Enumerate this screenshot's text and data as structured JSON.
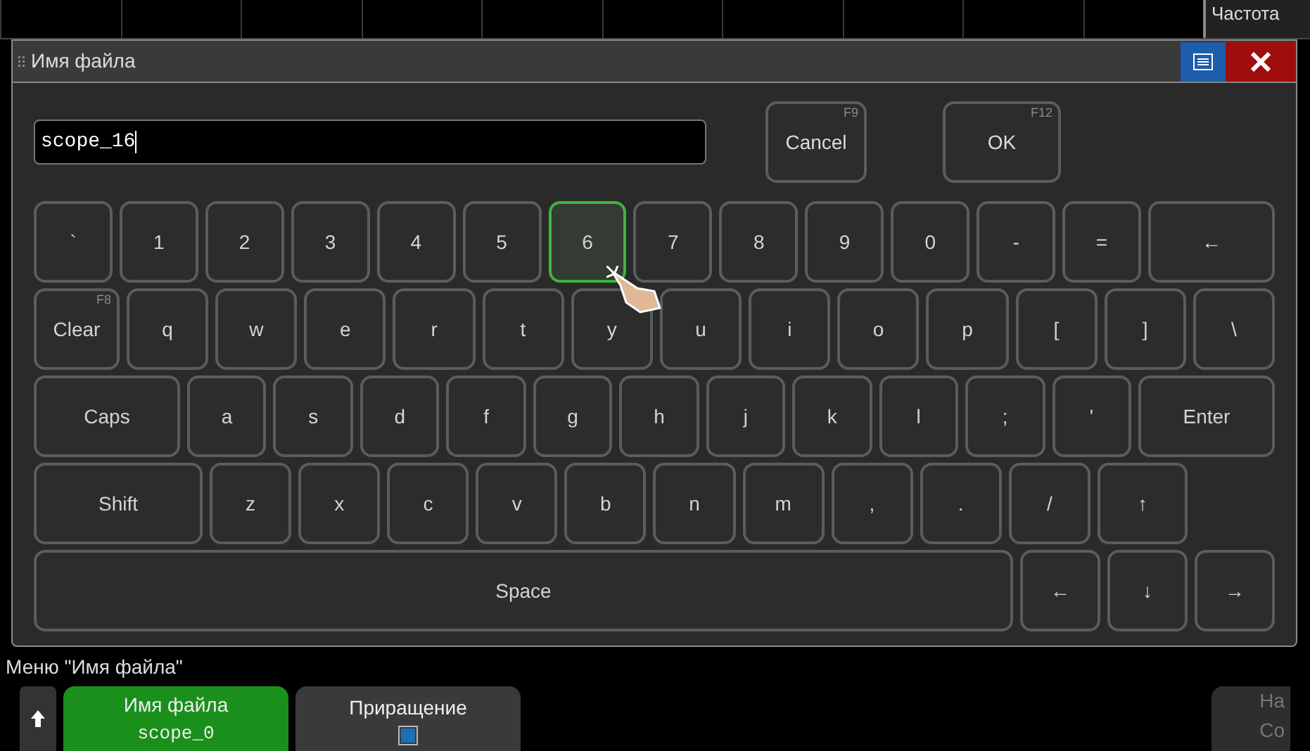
{
  "top_bar": {
    "label": "Частота"
  },
  "dialog": {
    "title": "Имя файла",
    "input": {
      "value": "scope_16"
    },
    "buttons": [
      {
        "label": "Cancel",
        "hint": "F9"
      },
      {
        "label": "OK",
        "hint": "F12"
      }
    ],
    "keyboard": [
      [
        {
          "label": "`",
          "kind": "char",
          "selected": false
        },
        {
          "label": "1",
          "kind": "char",
          "selected": false
        },
        {
          "label": "2",
          "kind": "char",
          "selected": false
        },
        {
          "label": "3",
          "kind": "char",
          "selected": false
        },
        {
          "label": "4",
          "kind": "char",
          "selected": false
        },
        {
          "label": "5",
          "kind": "char",
          "selected": false
        },
        {
          "label": "6",
          "kind": "char",
          "selected": true
        },
        {
          "label": "7",
          "kind": "char",
          "selected": false
        },
        {
          "label": "8",
          "kind": "char",
          "selected": false
        },
        {
          "label": "9",
          "kind": "char",
          "selected": false
        },
        {
          "label": "0",
          "kind": "char",
          "selected": false
        },
        {
          "label": "-",
          "kind": "char",
          "selected": false
        },
        {
          "label": "=",
          "kind": "char",
          "selected": false
        },
        {
          "label": "←",
          "kind": "backspace",
          "selected": false
        }
      ],
      [
        {
          "label": "Clear",
          "hint": "F8",
          "kind": "clear",
          "selected": false
        },
        {
          "label": "q",
          "kind": "char",
          "selected": false
        },
        {
          "label": "w",
          "kind": "char",
          "selected": false
        },
        {
          "label": "e",
          "kind": "char",
          "selected": false
        },
        {
          "label": "r",
          "kind": "char",
          "selected": false
        },
        {
          "label": "t",
          "kind": "char",
          "selected": false
        },
        {
          "label": "y",
          "kind": "char",
          "selected": false
        },
        {
          "label": "u",
          "kind": "char",
          "selected": false
        },
        {
          "label": "i",
          "kind": "char",
          "selected": false
        },
        {
          "label": "o",
          "kind": "char",
          "selected": false
        },
        {
          "label": "p",
          "kind": "char",
          "selected": false
        },
        {
          "label": "[",
          "kind": "char",
          "selected": false
        },
        {
          "label": "]",
          "kind": "char",
          "selected": false
        },
        {
          "label": "\\",
          "kind": "char",
          "selected": false
        }
      ],
      [
        {
          "label": "Caps",
          "kind": "caps",
          "selected": false
        },
        {
          "label": "a",
          "kind": "char",
          "selected": false
        },
        {
          "label": "s",
          "kind": "char",
          "selected": false
        },
        {
          "label": "d",
          "kind": "char",
          "selected": false
        },
        {
          "label": "f",
          "kind": "char",
          "selected": false
        },
        {
          "label": "g",
          "kind": "char",
          "selected": false
        },
        {
          "label": "h",
          "kind": "char",
          "selected": false
        },
        {
          "label": "j",
          "kind": "char",
          "selected": false
        },
        {
          "label": "k",
          "kind": "char",
          "selected": false
        },
        {
          "label": "l",
          "kind": "char",
          "selected": false
        },
        {
          "label": ";",
          "kind": "char",
          "selected": false
        },
        {
          "label": "'",
          "kind": "char",
          "selected": false
        },
        {
          "label": "Enter",
          "kind": "enter",
          "selected": false
        }
      ],
      [
        {
          "label": "Shift",
          "kind": "shift",
          "selected": false
        },
        {
          "label": "z",
          "kind": "char",
          "selected": false
        },
        {
          "label": "x",
          "kind": "char",
          "selected": false
        },
        {
          "label": "c",
          "kind": "char",
          "selected": false
        },
        {
          "label": "v",
          "kind": "char",
          "selected": false
        },
        {
          "label": "b",
          "kind": "char",
          "selected": false
        },
        {
          "label": "n",
          "kind": "char",
          "selected": false
        },
        {
          "label": "m",
          "kind": "char",
          "selected": false
        },
        {
          "label": ",",
          "kind": "char",
          "selected": false
        },
        {
          "label": ".",
          "kind": "char",
          "selected": false
        },
        {
          "label": "/",
          "kind": "char",
          "selected": false
        },
        {
          "label": "↑",
          "kind": "up",
          "selected": false
        }
      ],
      [
        {
          "label": "Space",
          "kind": "space",
          "selected": false
        },
        {
          "label": "←",
          "kind": "char",
          "selected": false
        },
        {
          "label": "↓",
          "kind": "char",
          "selected": false
        },
        {
          "label": "→",
          "kind": "char",
          "selected": false
        }
      ]
    ]
  },
  "menu": {
    "title": "Меню \"Имя файла\"",
    "softkeys": [
      {
        "kind": "name",
        "label": "Имя файла",
        "value": "scope_0",
        "selected": true
      },
      {
        "kind": "check",
        "label": "Приращение",
        "checked": true,
        "selected": false
      }
    ],
    "right_softkey": {
      "lines": [
        "На",
        "Со"
      ]
    }
  }
}
